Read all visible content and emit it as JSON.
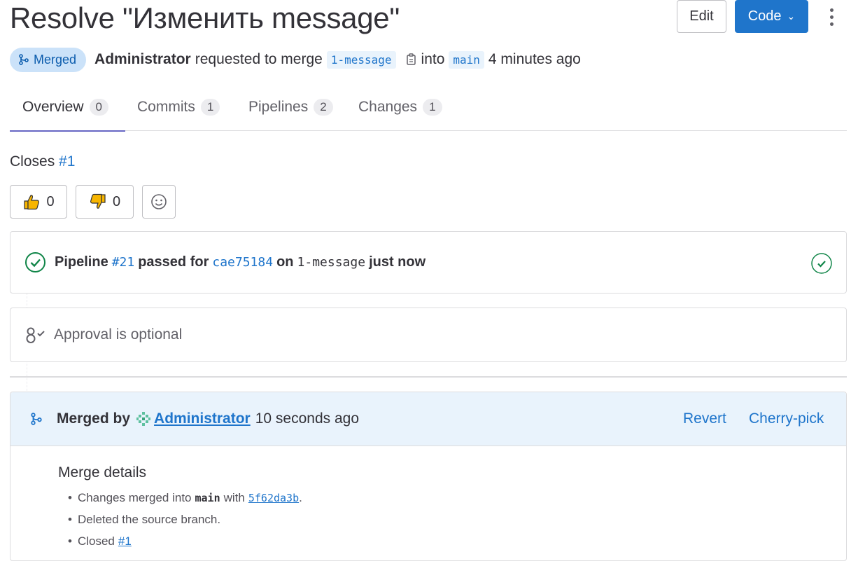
{
  "header": {
    "title": "Resolve \"Изменить message\"",
    "edit_label": "Edit",
    "code_label": "Code"
  },
  "meta": {
    "status": "Merged",
    "author": "Administrator",
    "requested_text": "requested to merge",
    "source_branch": "1-message",
    "into_text": "into",
    "target_branch": "main",
    "time": "4 minutes ago"
  },
  "tabs": [
    {
      "label": "Overview",
      "count": "0"
    },
    {
      "label": "Commits",
      "count": "1"
    },
    {
      "label": "Pipelines",
      "count": "2"
    },
    {
      "label": "Changes",
      "count": "1"
    }
  ],
  "closes": {
    "prefix": "Closes",
    "issue": "#1"
  },
  "reactions": {
    "thumbs_up": "0",
    "thumbs_down": "0"
  },
  "pipeline": {
    "label": "Pipeline",
    "id": "#21",
    "passed_for": "passed for",
    "commit": "cae75184",
    "on": "on",
    "branch": "1-message",
    "time": "just now"
  },
  "approval": {
    "text": "Approval is optional"
  },
  "merged": {
    "merged_by": "Merged by",
    "user": "Administrator",
    "time": "10 seconds ago",
    "revert_label": "Revert",
    "cherry_pick_label": "Cherry-pick",
    "details_title": "Merge details",
    "line1_prefix": "Changes merged into",
    "line1_branch": "main",
    "line1_with": "with",
    "line1_commit": "5f62da3b",
    "line1_suffix": ".",
    "line2": "Deleted the source branch.",
    "line3_prefix": "Closed",
    "line3_issue": "#1"
  },
  "colors": {
    "accent_blue": "#1f75cb",
    "success_green": "#108548",
    "tab_indicator": "#6666c4",
    "merged_badge_bg": "#cbe2f9"
  },
  "icons": [
    "merge-icon",
    "copy-icon",
    "thumbs-up-icon",
    "thumbs-down-icon",
    "smiley-icon",
    "check-circle-icon",
    "approval-icon",
    "kebab-icon",
    "chevron-down-icon"
  ]
}
